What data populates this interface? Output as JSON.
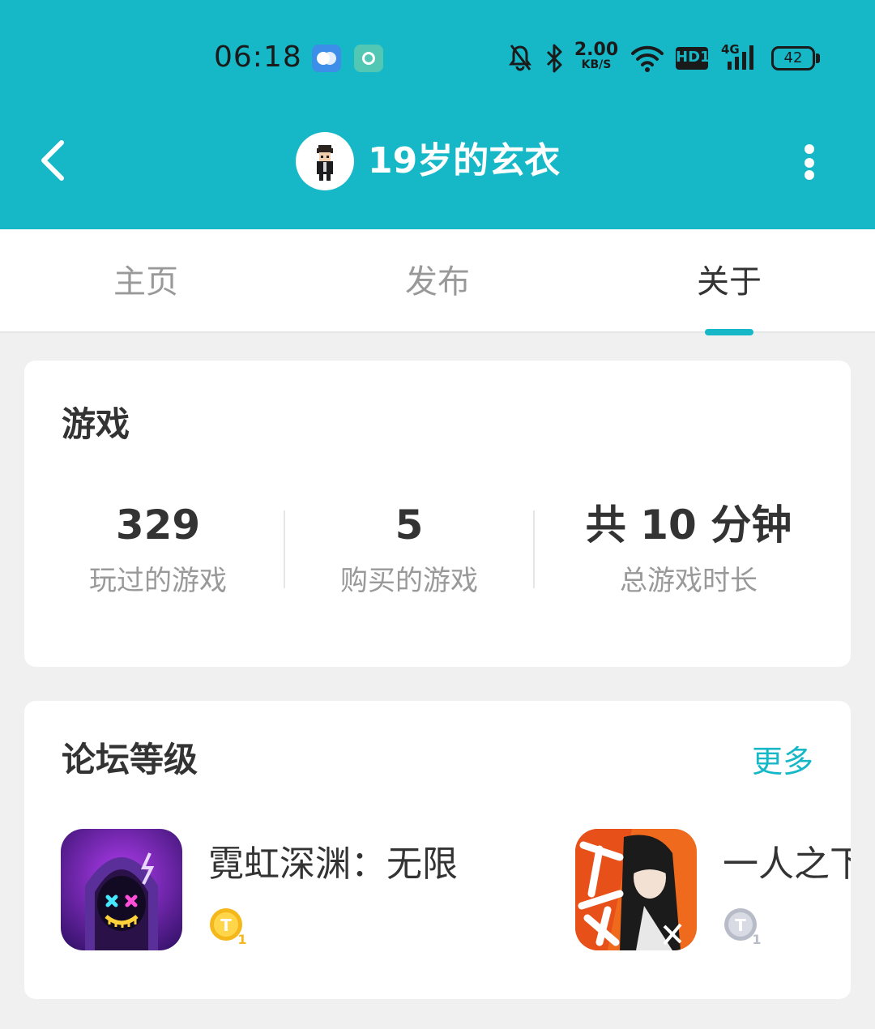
{
  "status_bar": {
    "time": "06:18",
    "net_speed_value": "2.00",
    "net_speed_unit": "KB/S",
    "hd_label": "HD1",
    "network_type": "4G",
    "battery": "42"
  },
  "header": {
    "title": "19岁的玄衣",
    "background_color": "#16b8c8"
  },
  "tabs": [
    {
      "label": "主页",
      "active": false
    },
    {
      "label": "发布",
      "active": false
    },
    {
      "label": "关于",
      "active": true
    }
  ],
  "games_card": {
    "title": "游戏",
    "stats": [
      {
        "value": "329",
        "label": "玩过的游戏"
      },
      {
        "value": "5",
        "label": "购买的游戏"
      },
      {
        "value": "共 10 分钟",
        "label": "总游戏时长"
      }
    ]
  },
  "forum_card": {
    "title": "论坛等级",
    "more_label": "更多",
    "items": [
      {
        "name": "霓虹深渊：无限",
        "badge": "T1",
        "badge_color": "#f5b81c"
      },
      {
        "name": "一人之下",
        "badge": "T1",
        "badge_color": "#b8bcc8"
      }
    ]
  },
  "accent_color": "#16b8c8"
}
